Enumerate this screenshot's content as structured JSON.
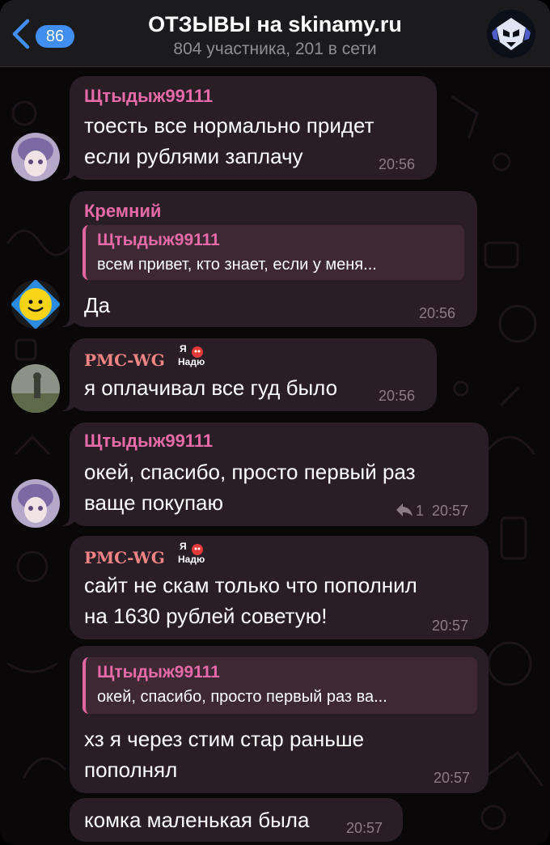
{
  "header": {
    "unread_count": "86",
    "title": "ОТЗЫВЫ на skinamy.ru",
    "subtitle": "804 участника, 201 в сети"
  },
  "messages": [
    {
      "sender": "Щтыдыж99111",
      "text": "тоесть все нормально придет\nесли рублями заплачу",
      "time": "20:56"
    },
    {
      "sender": "Кремний",
      "reply_to_name": "Щтыдыж99111",
      "reply_to_text": "всем привет, кто знает, если у меня...",
      "text": "Да",
      "time": "20:56"
    },
    {
      "sender": "PMC-WG",
      "sticker_text": [
        "Я",
        "Надю"
      ],
      "text": "я оплачивал все гуд было",
      "time": "20:56"
    },
    {
      "sender": "Щтыдыж99111",
      "text": "окей, спасибо, просто первый раз\nваще покупаю",
      "reply_count": "1",
      "time": "20:57"
    },
    {
      "sender": "PMC-WG",
      "sticker_text": [
        "Я",
        "Надю"
      ],
      "text": "сайт не скам только что пополнил\nна 1630 рублей советую!",
      "time": "20:57"
    },
    {
      "reply_to_name": "Щтыдыж99111",
      "reply_to_text": "окей, спасибо, просто первый раз ва...",
      "text": "хз я через стим стар раньше\nпополнял",
      "time": "20:57"
    },
    {
      "text": "комка маленькая была",
      "time": "20:57"
    }
  ],
  "colors": {
    "header_bg": "#1b1b1d",
    "bubble_bg": "#2a1e26",
    "accent_blue": "#3f8ef0",
    "sender_pink": "#e56aa8",
    "sender_pmc": "#f08383"
  },
  "icons": [
    "back-chevron-icon",
    "reply-arrow-icon",
    "group-avatar-icon"
  ]
}
